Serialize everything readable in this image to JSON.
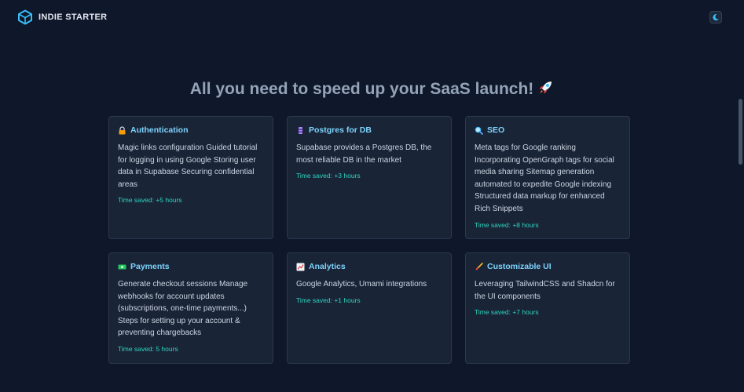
{
  "header": {
    "brand": "INDIE STARTER",
    "theme_toggle_icon": "moon-icon"
  },
  "hero": {
    "headline": "All you need to speed up your SaaS launch!",
    "headline_icon": "rocket-icon"
  },
  "features": [
    {
      "icon": "lock-icon",
      "title": "Authentication",
      "description": "Magic links configuration Guided tutorial for logging in using Google Storing user data in Supabase Securing confidential areas",
      "time_saved": "Time saved: +5 hours"
    },
    {
      "icon": "database-icon",
      "title": "Postgres for DB",
      "description": "Supabase provides a Postgres DB, the most reliable DB in the market",
      "time_saved": "Time saved: +3 hours"
    },
    {
      "icon": "magnifier-icon",
      "title": "SEO",
      "description": "Meta tags for Google ranking Incorporating OpenGraph tags for social media sharing Sitemap generation automated to expedite Google indexing Structured data markup for enhanced Rich Snippets",
      "time_saved": "Time saved: +8 hours"
    },
    {
      "icon": "money-icon",
      "title": "Payments",
      "description": "Generate checkout sessions Manage webhooks for account updates (subscriptions, one-time payments...) Steps for setting up your account & preventing chargebacks",
      "time_saved": "Time saved: 5 hours"
    },
    {
      "icon": "chart-icon",
      "title": "Analytics",
      "description": "Google Analytics, Umami integrations",
      "time_saved": "Time saved: +1 hours"
    },
    {
      "icon": "brush-icon",
      "title": "Customizable UI",
      "description": "Leveraging TailwindCSS and Shadcn for the UI components",
      "time_saved": "Time saved: +7 hours"
    }
  ],
  "colors": {
    "background": "#0f172a",
    "card": "#1a2437",
    "title_accent": "#7dd3fc",
    "time_saved": "#2dd4bf"
  }
}
